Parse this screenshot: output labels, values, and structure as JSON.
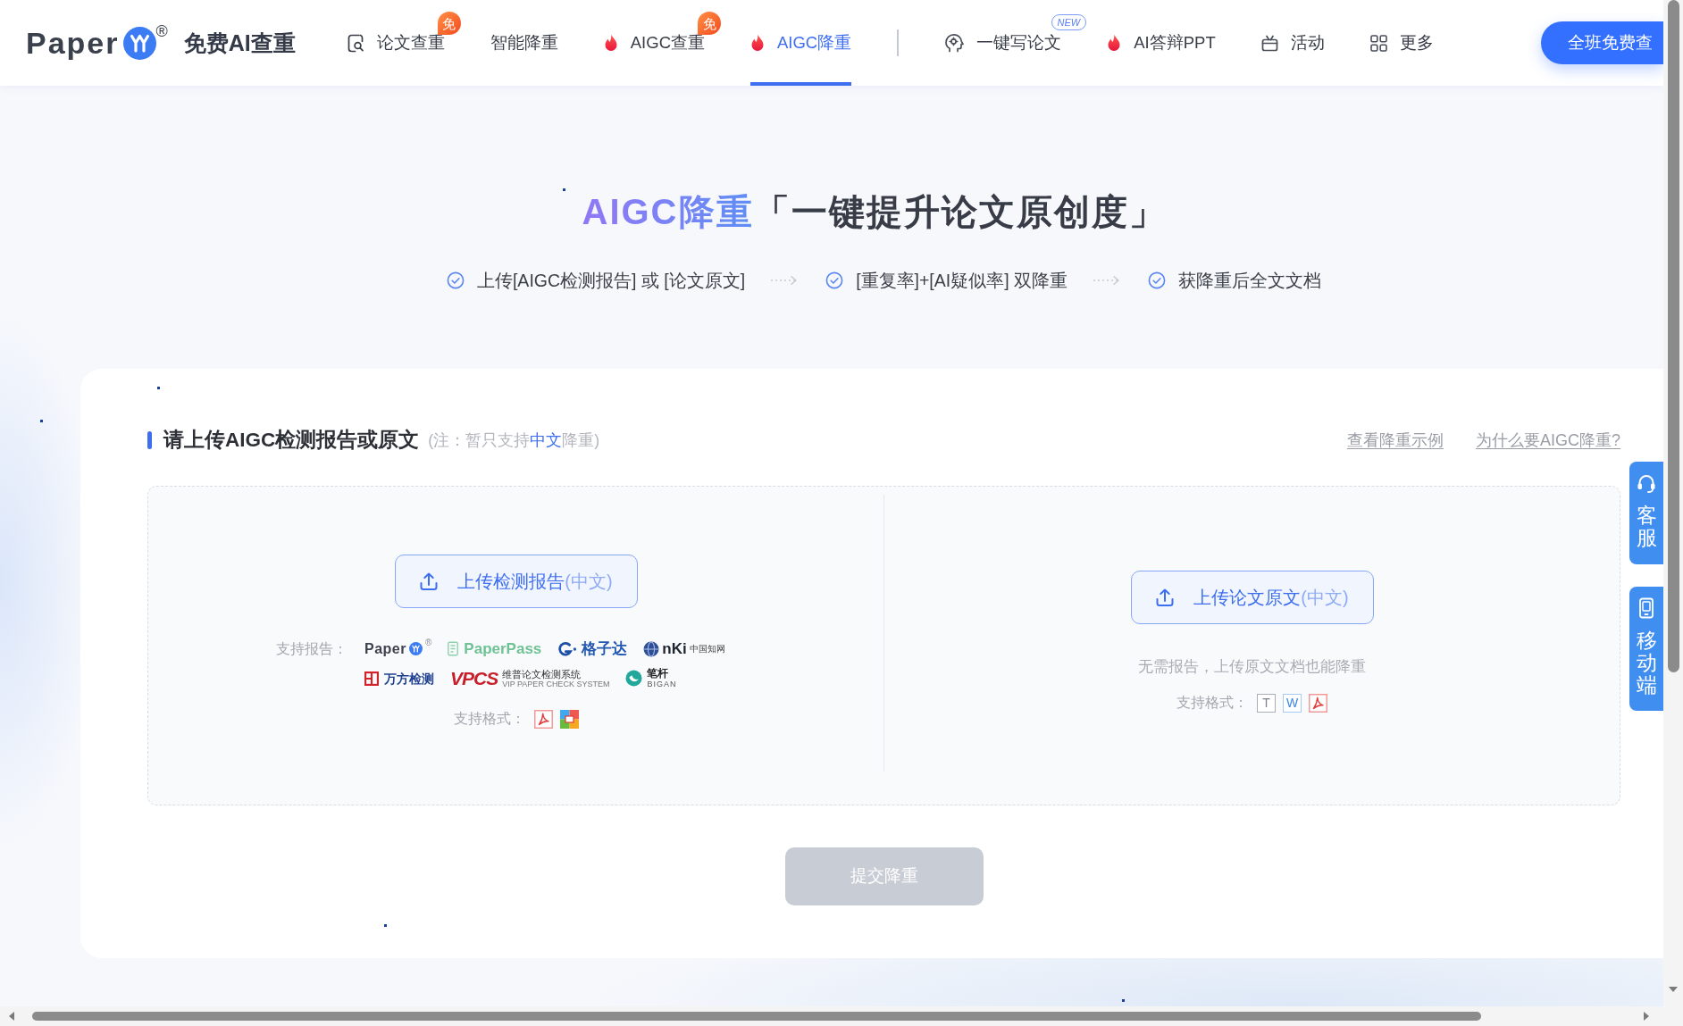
{
  "header": {
    "logo": {
      "wordmark": "Paper",
      "registered": "®",
      "tagline": "免费AI查重"
    },
    "nav": [
      {
        "kind": "search",
        "label": "论文查重",
        "badge": {
          "kind": "free",
          "text": "免"
        },
        "selected": false
      },
      {
        "kind": "plain",
        "label": "智能降重",
        "selected": false
      },
      {
        "kind": "hot",
        "label": "AIGC查重",
        "badge": {
          "kind": "free",
          "text": "免"
        },
        "selected": false
      },
      {
        "kind": "hot",
        "label": "AIGC降重",
        "selected": true
      }
    ],
    "nav_more": [
      {
        "kind": "head",
        "label": "一键写论文",
        "badge": {
          "kind": "new",
          "text": "NEW"
        },
        "selected": false
      },
      {
        "kind": "hot",
        "label": "AI答辩PPT",
        "selected": false
      },
      {
        "kind": "calendar",
        "label": "活动",
        "selected": false
      },
      {
        "kind": "grid",
        "label": "更多",
        "selected": false
      }
    ],
    "cta_button": "全班免费查"
  },
  "hero": {
    "title": {
      "accent": "AIGC降重",
      "text": "「一键提升论文原创度」"
    },
    "steps": [
      "上传[AIGC检测报告] 或 [论文原文]",
      "[重复率]+[AI疑似率] 双降重",
      "获降重后全文文档"
    ]
  },
  "upload_card": {
    "title": "请上传AIGC检测报告或原文",
    "note": {
      "prefix": "(注：暂只支持",
      "emphasis": "中文",
      "suffix": "降重)"
    },
    "links": [
      "查看降重示例",
      "为什么要AIGC降重?"
    ],
    "panels": [
      {
        "button": {
          "label": "上传检测报告",
          "hint": "(中文)"
        },
        "brands_label": "支持报告：",
        "brands": [
          {
            "kind": "paperyy",
            "name": "Paper",
            "mark": "®"
          },
          {
            "kind": "paperpass",
            "name": "PaperPass"
          },
          {
            "kind": "gezida",
            "name": "格子达"
          },
          {
            "kind": "cnki",
            "name": "nKi",
            "subtitle": "中国知网"
          },
          {
            "kind": "wanfang",
            "name": "万方检测"
          },
          {
            "kind": "vpcs",
            "name": "VPCS",
            "subtitle": "维普论文检测系统",
            "caption": "VIP PAPER CHECK SYSTEM"
          },
          {
            "kind": "bigan",
            "name": "笔杆",
            "caption": "BIGAN"
          }
        ],
        "formats_label": "支持格式：",
        "formats": [
          {
            "kind": "pdf"
          },
          {
            "kind": "image"
          }
        ]
      },
      {
        "button": {
          "label": "上传论文原文",
          "hint": "(中文)"
        },
        "description": "无需报告，上传原文文档也能降重",
        "formats_label": "支持格式：",
        "formats": [
          {
            "kind": "txt",
            "text": "T"
          },
          {
            "kind": "word",
            "text": "W"
          },
          {
            "kind": "pdf"
          }
        ]
      }
    ],
    "submit": {
      "label": "提交降重",
      "disabled": true
    }
  },
  "side_tabs": [
    {
      "kind": "support",
      "label": "客服"
    },
    {
      "kind": "mobile",
      "label": "移动端"
    }
  ]
}
